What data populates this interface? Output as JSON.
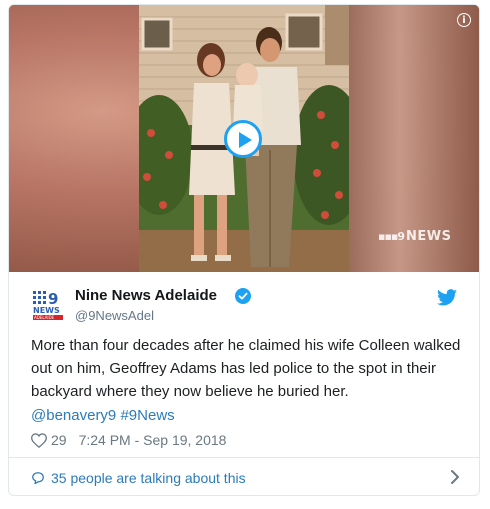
{
  "tweet": {
    "author_name": "Nine News Adelaide",
    "handle": "@9NewsAdel",
    "text": "More than four decades after he claimed his wife Colleen walked out on him, Geoffrey Adams has led police to the spot in their backyard where they now believe he buried her.",
    "mentions": [
      "@benavery9",
      "#9News"
    ],
    "likes": "29",
    "timestamp": "7:24 PM - Sep 19, 2018",
    "talking": "35 people are talking about this"
  },
  "media": {
    "watermark": "NEWS",
    "info_icon": "info-icon",
    "play_icon": "play-icon"
  },
  "avatar_logo": {
    "top": "9",
    "mid": "NEWS",
    "bottom": "ADELAIDE"
  },
  "colors": {
    "twitter_blue": "#1da1f2",
    "link": "#2b7bb9",
    "muted": "#697882",
    "logo_red": "#d6262d"
  }
}
